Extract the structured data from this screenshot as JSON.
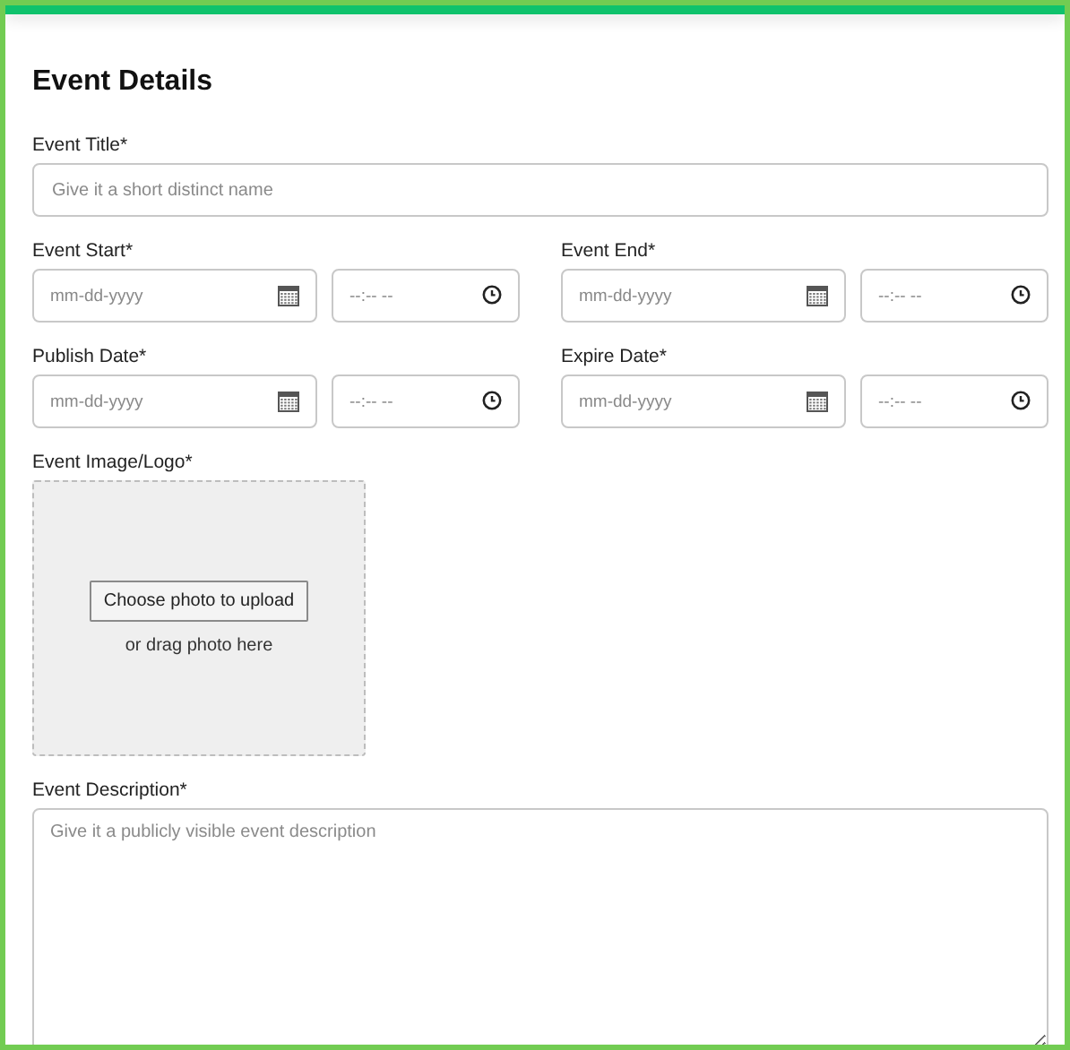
{
  "heading": "Event Details",
  "title_field": {
    "label": "Event Title*",
    "placeholder": "Give it a short distinct name"
  },
  "schedule": [
    {
      "label": "Event Start*",
      "date_placeholder": "mm-dd-yyyy",
      "time_placeholder": "--:-- --"
    },
    {
      "label": "Event End*",
      "date_placeholder": "mm-dd-yyyy",
      "time_placeholder": "--:-- --"
    },
    {
      "label": "Publish Date*",
      "date_placeholder": "mm-dd-yyyy",
      "time_placeholder": "--:-- --"
    },
    {
      "label": "Expire Date*",
      "date_placeholder": "mm-dd-yyyy",
      "time_placeholder": "--:-- --"
    }
  ],
  "image_upload": {
    "label": "Event Image/Logo*",
    "button": "Choose photo to upload",
    "hint": "or drag photo here"
  },
  "description": {
    "label": "Event Description*",
    "placeholder": "Give it a publicly visible event description"
  }
}
